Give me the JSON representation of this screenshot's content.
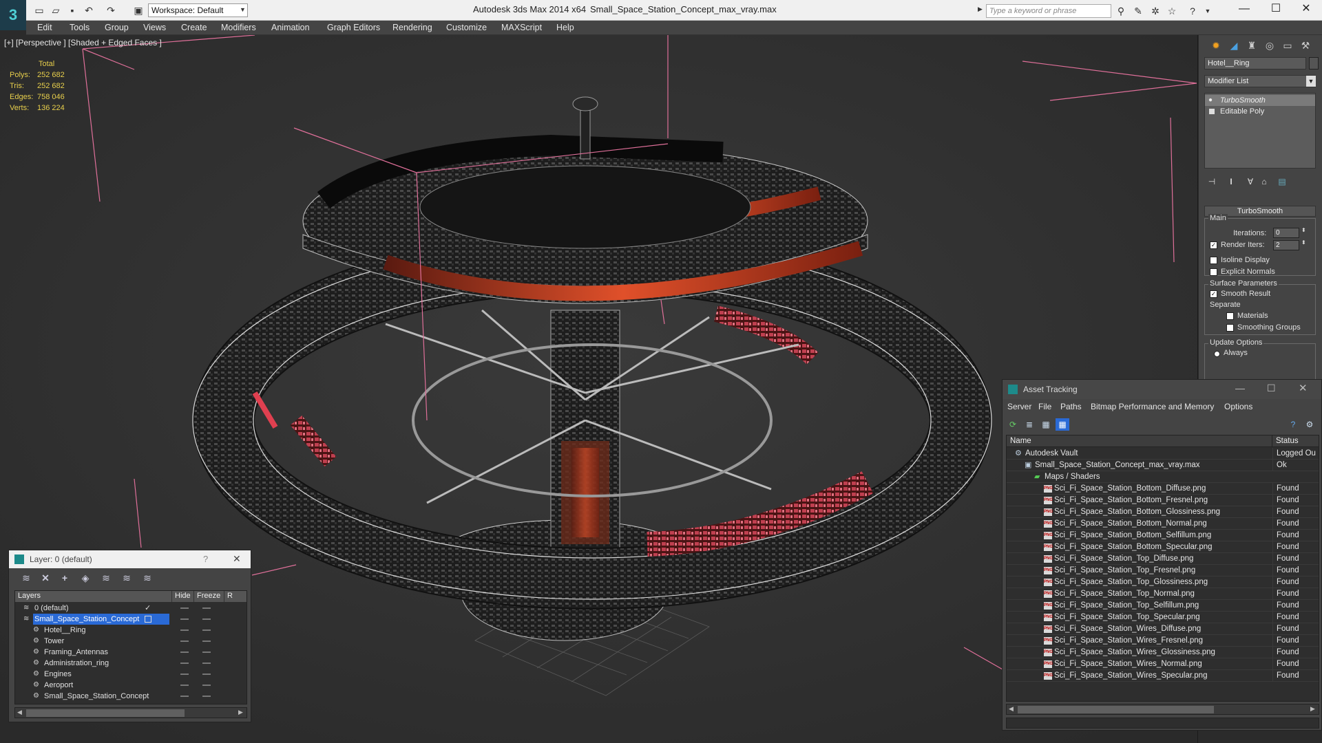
{
  "titlebar": {
    "workspace": "Workspace: Default",
    "app_title": "Autodesk 3ds Max  2014 x64",
    "file_title": "Small_Space_Station_Concept_max_vray.max",
    "search_placeholder": "Type a keyword or phrase"
  },
  "menu": [
    "Edit",
    "Tools",
    "Group",
    "Views",
    "Create",
    "Modifiers",
    "Animation",
    "Graph Editors",
    "Rendering",
    "Customize",
    "MAXScript",
    "Help"
  ],
  "viewport": {
    "label": "[+] [Perspective ] [Shaded + Edged Faces ]",
    "stats_title": "Total",
    "stats": [
      {
        "label": "Polys:",
        "value": "252 682"
      },
      {
        "label": "Tris:",
        "value": "252 682"
      },
      {
        "label": "Edges:",
        "value": "758 046"
      },
      {
        "label": "Verts:",
        "value": "136 224"
      }
    ]
  },
  "command_panel": {
    "object_name": "Hotel__Ring",
    "modifier_list": "Modifier List",
    "stack": [
      "TurboSmooth",
      "Editable Poly"
    ],
    "rollout_title": "TurboSmooth",
    "main_label": "Main",
    "iterations_label": "Iterations:",
    "iterations_value": "0",
    "render_iters_label": "Render Iters:",
    "render_iters_value": "2",
    "isoline_label": "Isoline Display",
    "explicit_normals_label": "Explicit Normals",
    "surface_params_label": "Surface Parameters",
    "smooth_result_label": "Smooth Result",
    "separate_label": "Separate",
    "materials_label": "Materials",
    "smoothing_groups_label": "Smoothing Groups",
    "update_options_label": "Update Options",
    "always_label": "Always"
  },
  "layer_dialog": {
    "title": "Layer: 0 (default)",
    "help": "?",
    "close": "✕",
    "columns": [
      "Layers",
      "Hide",
      "Freeze",
      "R"
    ],
    "rows": [
      {
        "name": "0 (default)",
        "indent": 0,
        "checked": true
      },
      {
        "name": "Small_Space_Station_Concept",
        "indent": 0,
        "selected": true
      },
      {
        "name": "Hotel__Ring",
        "indent": 1
      },
      {
        "name": "Tower",
        "indent": 1
      },
      {
        "name": "Framing_Antennas",
        "indent": 1
      },
      {
        "name": "Administration_ring",
        "indent": 1
      },
      {
        "name": "Engines",
        "indent": 1
      },
      {
        "name": "Aeroport",
        "indent": 1
      },
      {
        "name": "Small_Space_Station_Concept",
        "indent": 1
      }
    ]
  },
  "asset_dialog": {
    "title": "Asset Tracking",
    "menu": [
      "Server",
      "File",
      "Paths",
      "Bitmap Performance and Memory",
      "Options"
    ],
    "columns": [
      "Name",
      "Status"
    ],
    "rows": [
      {
        "name": "Autodesk Vault",
        "status": "Logged Ou",
        "level": 0,
        "icon": "vault-icon"
      },
      {
        "name": "Small_Space_Station_Concept_max_vray.max",
        "status": "Ok",
        "level": 1,
        "icon": "max-file-icon"
      },
      {
        "name": "Maps / Shaders",
        "status": "",
        "level": 2,
        "icon": "maps-icon"
      },
      {
        "name": "Sci_Fi_Space_Station_Bottom_Diffuse.png",
        "status": "Found",
        "level": 3,
        "icon": "png-icon"
      },
      {
        "name": "Sci_Fi_Space_Station_Bottom_Fresnel.png",
        "status": "Found",
        "level": 3,
        "icon": "png-icon"
      },
      {
        "name": "Sci_Fi_Space_Station_Bottom_Glossiness.png",
        "status": "Found",
        "level": 3,
        "icon": "png-icon"
      },
      {
        "name": "Sci_Fi_Space_Station_Bottom_Normal.png",
        "status": "Found",
        "level": 3,
        "icon": "png-icon"
      },
      {
        "name": "Sci_Fi_Space_Station_Bottom_Selfillum.png",
        "status": "Found",
        "level": 3,
        "icon": "png-icon"
      },
      {
        "name": "Sci_Fi_Space_Station_Bottom_Specular.png",
        "status": "Found",
        "level": 3,
        "icon": "png-icon"
      },
      {
        "name": "Sci_Fi_Space_Station_Top_Diffuse.png",
        "status": "Found",
        "level": 3,
        "icon": "png-icon"
      },
      {
        "name": "Sci_Fi_Space_Station_Top_Fresnel.png",
        "status": "Found",
        "level": 3,
        "icon": "png-icon"
      },
      {
        "name": "Sci_Fi_Space_Station_Top_Glossiness.png",
        "status": "Found",
        "level": 3,
        "icon": "png-icon"
      },
      {
        "name": "Sci_Fi_Space_Station_Top_Normal.png",
        "status": "Found",
        "level": 3,
        "icon": "png-icon"
      },
      {
        "name": "Sci_Fi_Space_Station_Top_Selfillum.png",
        "status": "Found",
        "level": 3,
        "icon": "png-icon"
      },
      {
        "name": "Sci_Fi_Space_Station_Top_Specular.png",
        "status": "Found",
        "level": 3,
        "icon": "png-icon"
      },
      {
        "name": "Sci_Fi_Space_Station_Wires_Diffuse.png",
        "status": "Found",
        "level": 3,
        "icon": "png-icon"
      },
      {
        "name": "Sci_Fi_Space_Station_Wires_Fresnel.png",
        "status": "Found",
        "level": 3,
        "icon": "png-icon"
      },
      {
        "name": "Sci_Fi_Space_Station_Wires_Glossiness.png",
        "status": "Found",
        "level": 3,
        "icon": "png-icon"
      },
      {
        "name": "Sci_Fi_Space_Station_Wires_Normal.png",
        "status": "Found",
        "level": 3,
        "icon": "png-icon"
      },
      {
        "name": "Sci_Fi_Space_Station_Wires_Specular.png",
        "status": "Found",
        "level": 3,
        "icon": "png-icon"
      }
    ]
  },
  "colors": {
    "selection_blue": "#2a6ad6",
    "stats_yellow": "#e8cf4c",
    "bbox_pink": "#e0709a",
    "glow_orange": "#e0502a"
  }
}
